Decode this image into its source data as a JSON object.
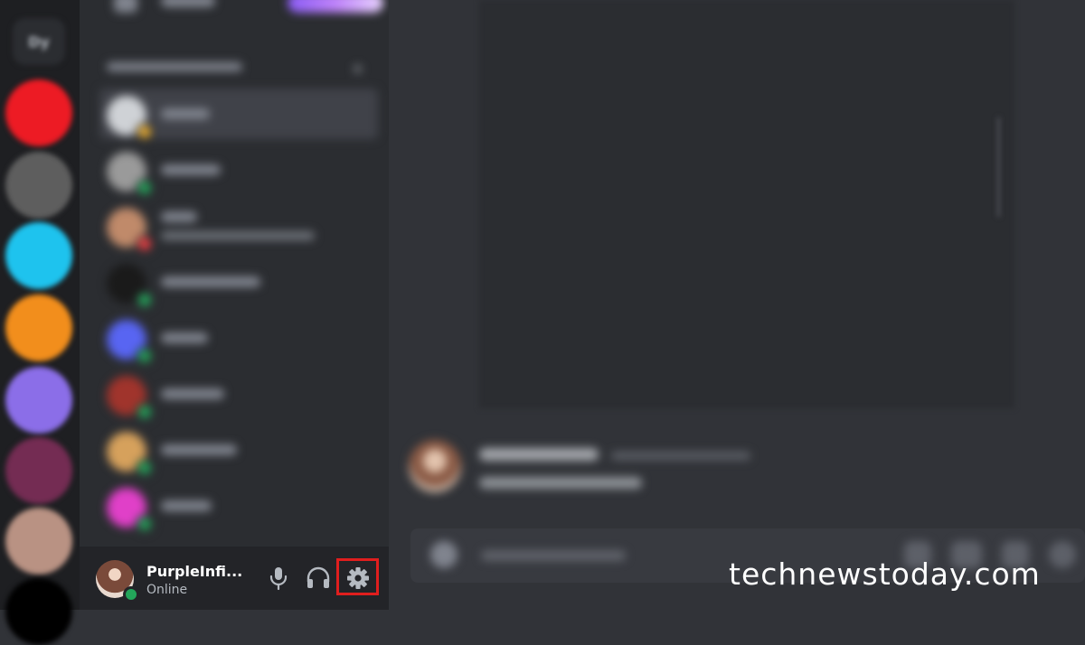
{
  "rail": {
    "dm_label": "Dy",
    "servers": [
      {
        "color": "#ed1b24"
      },
      {
        "color": "#5e5e5e"
      },
      {
        "color": "#1ec3ee"
      },
      {
        "color": "#f28e1c"
      },
      {
        "color": "#8b6ee8"
      },
      {
        "color": "#742c53"
      },
      {
        "color": "#b99283"
      },
      {
        "color": "#000000"
      }
    ]
  },
  "sidebar": {
    "direct_messages_add_icon": "plus-icon",
    "dms": [
      {
        "avatar": "#cfd2d6",
        "status": "#f0b232",
        "selected": true
      },
      {
        "avatar": "#9a9a9a",
        "status": "#23a55a"
      },
      {
        "avatar": "#c08a6a",
        "status": "#f23f43"
      },
      {
        "avatar": "#1a1a1a",
        "status": "#23a55a"
      },
      {
        "avatar": "#5865f2",
        "status": "#23a55a"
      },
      {
        "avatar": "#a0342c",
        "status": "#23a55a"
      },
      {
        "avatar": "#d6a15c",
        "status": "#23a55a"
      },
      {
        "avatar": "#e040c8",
        "status": "#23a55a"
      }
    ]
  },
  "user_panel": {
    "username": "PurpleInfi...",
    "status_text": "Online",
    "mic_icon": "microphone-icon",
    "headset_icon": "headphones-icon",
    "settings_icon": "gear-icon",
    "highlight_color": "#e01e1e"
  },
  "watermark": "technewstoday.com"
}
